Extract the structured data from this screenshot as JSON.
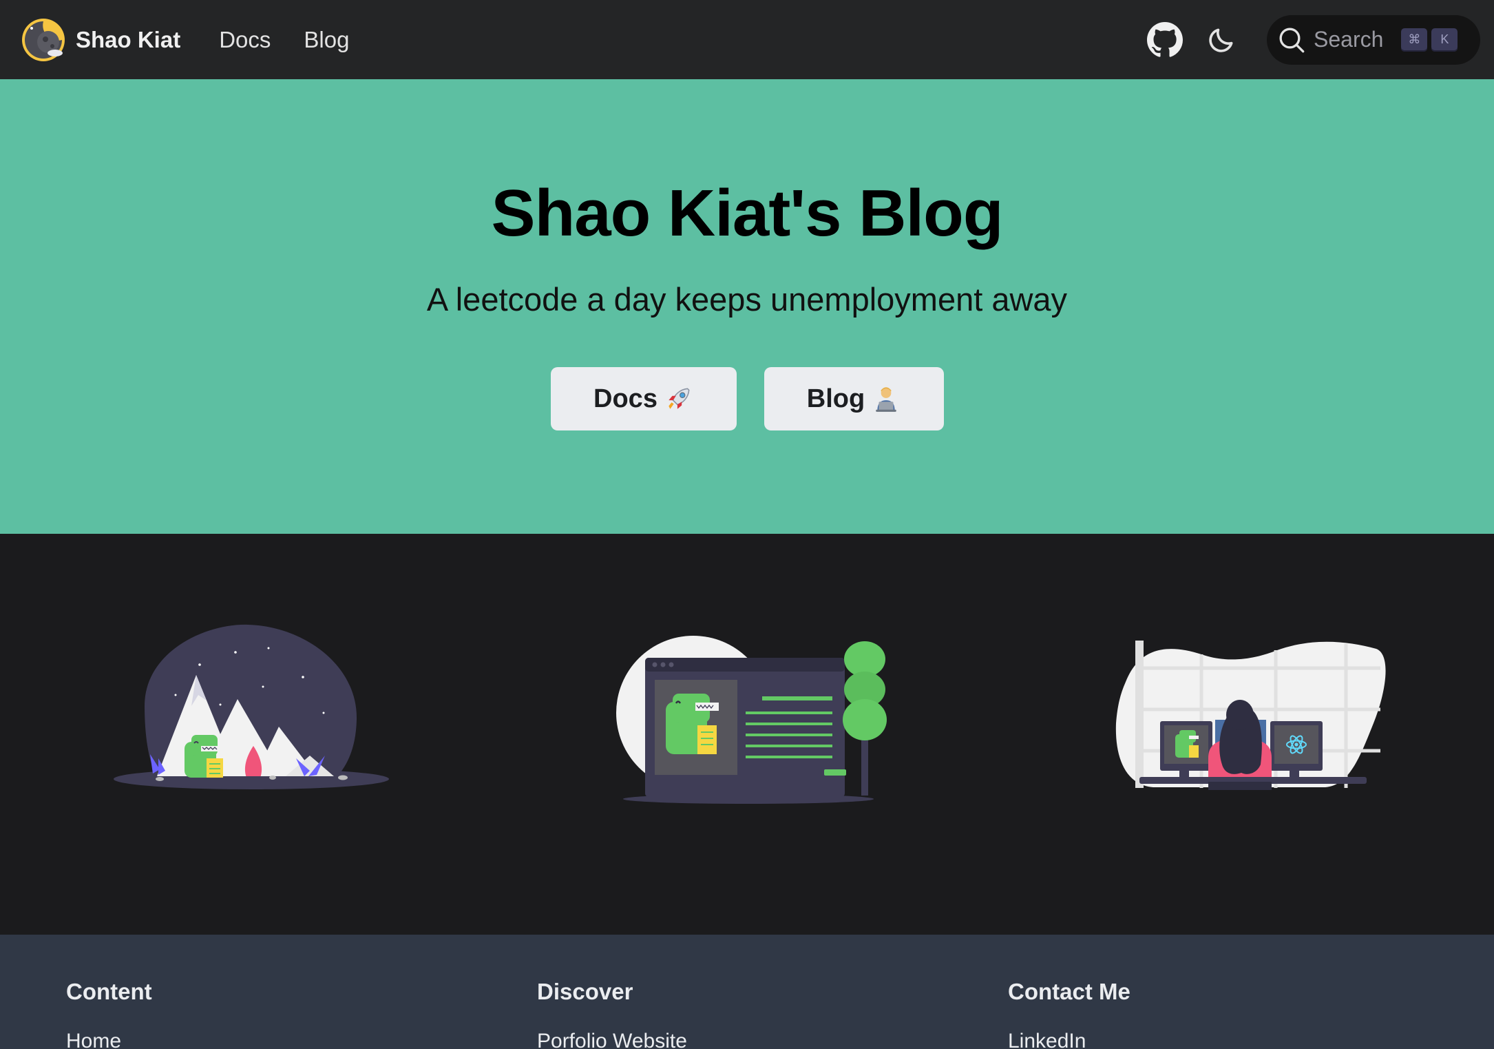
{
  "navbar": {
    "brand_title": "Shao Kiat",
    "links": [
      "Docs",
      "Blog"
    ],
    "github_icon": "github-icon",
    "theme_icon": "moon-icon",
    "search": {
      "placeholder": "Search",
      "keys": [
        "⌘",
        "K"
      ]
    }
  },
  "hero": {
    "title": "Shao Kiat's Blog",
    "subtitle": "A leetcode a day keeps unemployment away",
    "buttons": [
      {
        "label": "Docs",
        "icon": "rocket-icon"
      },
      {
        "label": "Blog",
        "icon": "technologist-icon"
      }
    ]
  },
  "features": {
    "illustrations": [
      "mountain-dino-illustration",
      "browser-dino-illustration",
      "desk-react-illustration"
    ]
  },
  "footer": {
    "columns": [
      {
        "title": "Content",
        "links": [
          "Home"
        ]
      },
      {
        "title": "Discover",
        "links": [
          "Porfolio Website"
        ]
      },
      {
        "title": "Contact Me",
        "links": [
          "LinkedIn"
        ]
      }
    ]
  },
  "colors": {
    "navbar_bg": "#242526",
    "hero_bg": "#5dbfa2",
    "page_bg": "#1b1b1d",
    "footer_bg": "#303846",
    "button_bg": "#ebedf0"
  }
}
